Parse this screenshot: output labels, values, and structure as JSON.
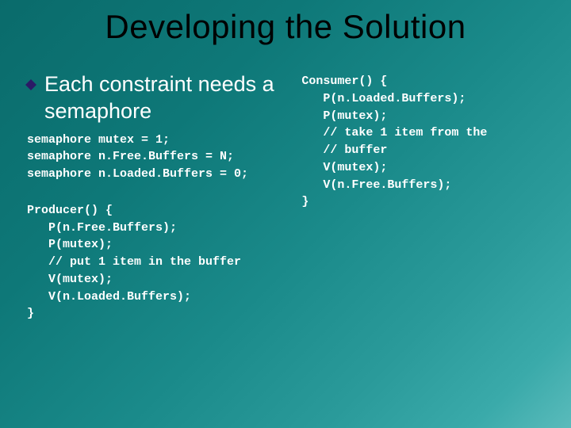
{
  "title": "Developing the Solution",
  "bullet": "Each constraint needs a semaphore",
  "decl": {
    "l1": "semaphore mutex = 1;",
    "l2": "semaphore n.Free.Buffers = N;",
    "l3": "semaphore n.Loaded.Buffers = 0;"
  },
  "producer": {
    "l1": "Producer() {",
    "l2": "   P(n.Free.Buffers);",
    "l3": "   P(mutex);",
    "l4": "   // put 1 item in the buffer",
    "l5": "   V(mutex);",
    "l6": "   V(n.Loaded.Buffers);",
    "l7": "}"
  },
  "consumer": {
    "l1": "Consumer() {",
    "l2": "   P(n.Loaded.Buffers);",
    "l3": "   P(mutex);",
    "l4": "   // take 1 item from the",
    "l5": "   // buffer",
    "l6": "   V(mutex);",
    "l7": "   V(n.Free.Buffers);",
    "l8": "}"
  }
}
